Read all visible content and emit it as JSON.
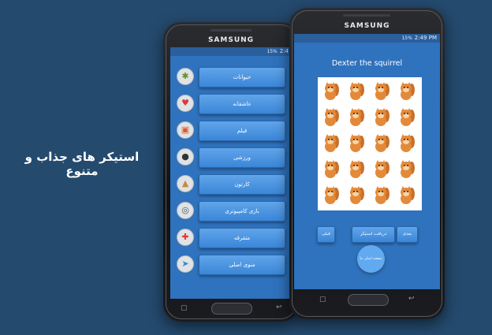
{
  "tagline": "استیکر های جذاب و متنوع",
  "phone1": {
    "brand": "SAMSUNG",
    "status": {
      "signal": "15%",
      "time": "2:4"
    },
    "categories": [
      {
        "label": "حیوانات",
        "icon": "paw-icon",
        "icon_color": "#6a8f2c"
      },
      {
        "label": "عاشقانه",
        "icon": "heart-icon",
        "icon_color": "#e0373a"
      },
      {
        "label": "فیلم",
        "icon": "film-icon",
        "icon_color": "#e0592a"
      },
      {
        "label": "ورزشی",
        "icon": "soccer-ball-icon",
        "icon_color": "#333333"
      },
      {
        "label": "کارتون",
        "icon": "giraffe-icon",
        "icon_color": "#c98a38"
      },
      {
        "label": "بازی کامپیوتری",
        "icon": "gamepad-icon",
        "icon_color": "#4c5a63"
      },
      {
        "label": "متفرقه",
        "icon": "plus-icon",
        "icon_color": "#e0373a"
      },
      {
        "label": "منوی اصلی",
        "icon": "telegram-icon",
        "icon_color": "#2f8bd1"
      }
    ]
  },
  "phone2": {
    "brand": "SAMSUNG",
    "status": {
      "signal": "15%",
      "time": "2:49 PM"
    },
    "pack_title": "Dexter the squirrel",
    "buttons": {
      "prev": "قبلی",
      "download": "دریافت استیکر",
      "next": "بعدی"
    },
    "circle_label": "صفحه اصلی ما"
  },
  "colors": {
    "background": "#244a6e",
    "screen": "#2f72bd",
    "button": "#4a93e0",
    "sticker_fur": "#e38a3a"
  }
}
